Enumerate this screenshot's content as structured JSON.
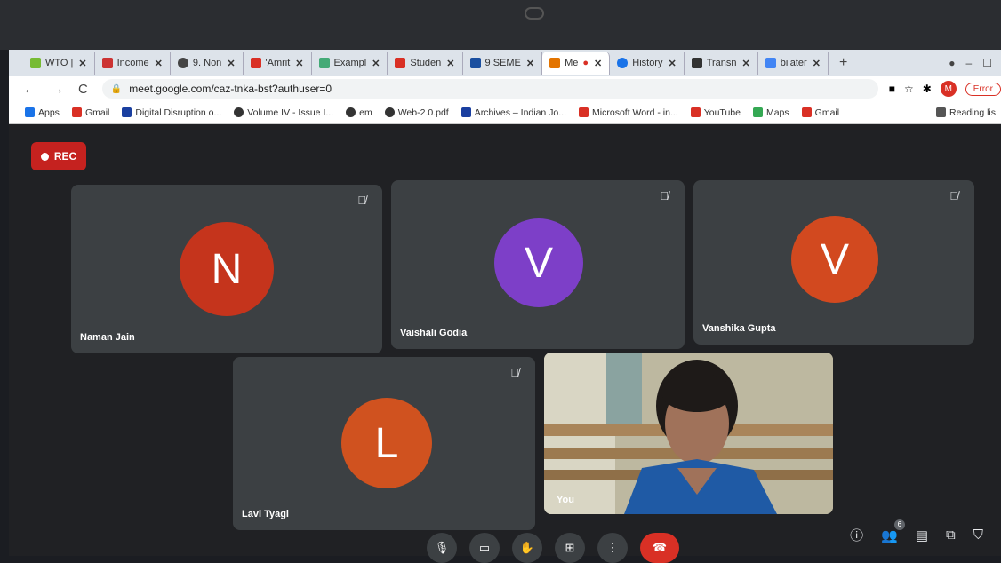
{
  "tabs": [
    {
      "label": "WTO |",
      "color": "#7b3"
    },
    {
      "label": "Income",
      "color": "#c33"
    },
    {
      "label": "9. Non",
      "color": "#444"
    },
    {
      "label": "'Amrit",
      "color": "#d93025"
    },
    {
      "label": "Exampl",
      "color": "#4a7"
    },
    {
      "label": "Studen",
      "color": "#d93025"
    },
    {
      "label": "9 SEME",
      "color": "#1a4fa0"
    },
    {
      "label": "Me",
      "color": "#e37400",
      "active": true
    },
    {
      "label": "History",
      "color": "#1a73e8"
    },
    {
      "label": "Transn",
      "color": "#333"
    },
    {
      "label": "bilater",
      "color": "#4285f4"
    }
  ],
  "address": {
    "url": "meet.google.com/caz-tnka-bst?authuser=0",
    "profile_initial": "M",
    "error_label": "Error"
  },
  "bookmarks": [
    {
      "label": "Apps",
      "color": "#1a73e8"
    },
    {
      "label": "Gmail",
      "color": "#d93025"
    },
    {
      "label": "Digital Disruption o...",
      "color": "#1a3fa0"
    },
    {
      "label": "Volume IV - Issue I...",
      "color": "#333"
    },
    {
      "label": "em",
      "color": "#333"
    },
    {
      "label": "Web-2.0.pdf",
      "color": "#333"
    },
    {
      "label": "Archives – Indian Jo...",
      "color": "#1a3fa0"
    },
    {
      "label": "Microsoft Word - in...",
      "color": "#d93025"
    },
    {
      "label": "YouTube",
      "color": "#d93025"
    },
    {
      "label": "Maps",
      "color": "#34a853"
    },
    {
      "label": "Gmail",
      "color": "#d93025"
    },
    {
      "label": "Reading lis",
      "color": "#555"
    }
  ],
  "meet": {
    "rec_label": "REC",
    "participants": [
      {
        "name": "Naman Jain",
        "initial": "N",
        "color": "#c5341c"
      },
      {
        "name": "Vaishali Godia",
        "initial": "V",
        "color": "#7d3fc8"
      },
      {
        "name": "Vanshika Gupta",
        "initial": "V",
        "color": "#d2491f"
      },
      {
        "name": "Lavi Tyagi",
        "initial": "L",
        "color": "#d0521f"
      }
    ],
    "self_label": "You",
    "people_count": "6"
  }
}
